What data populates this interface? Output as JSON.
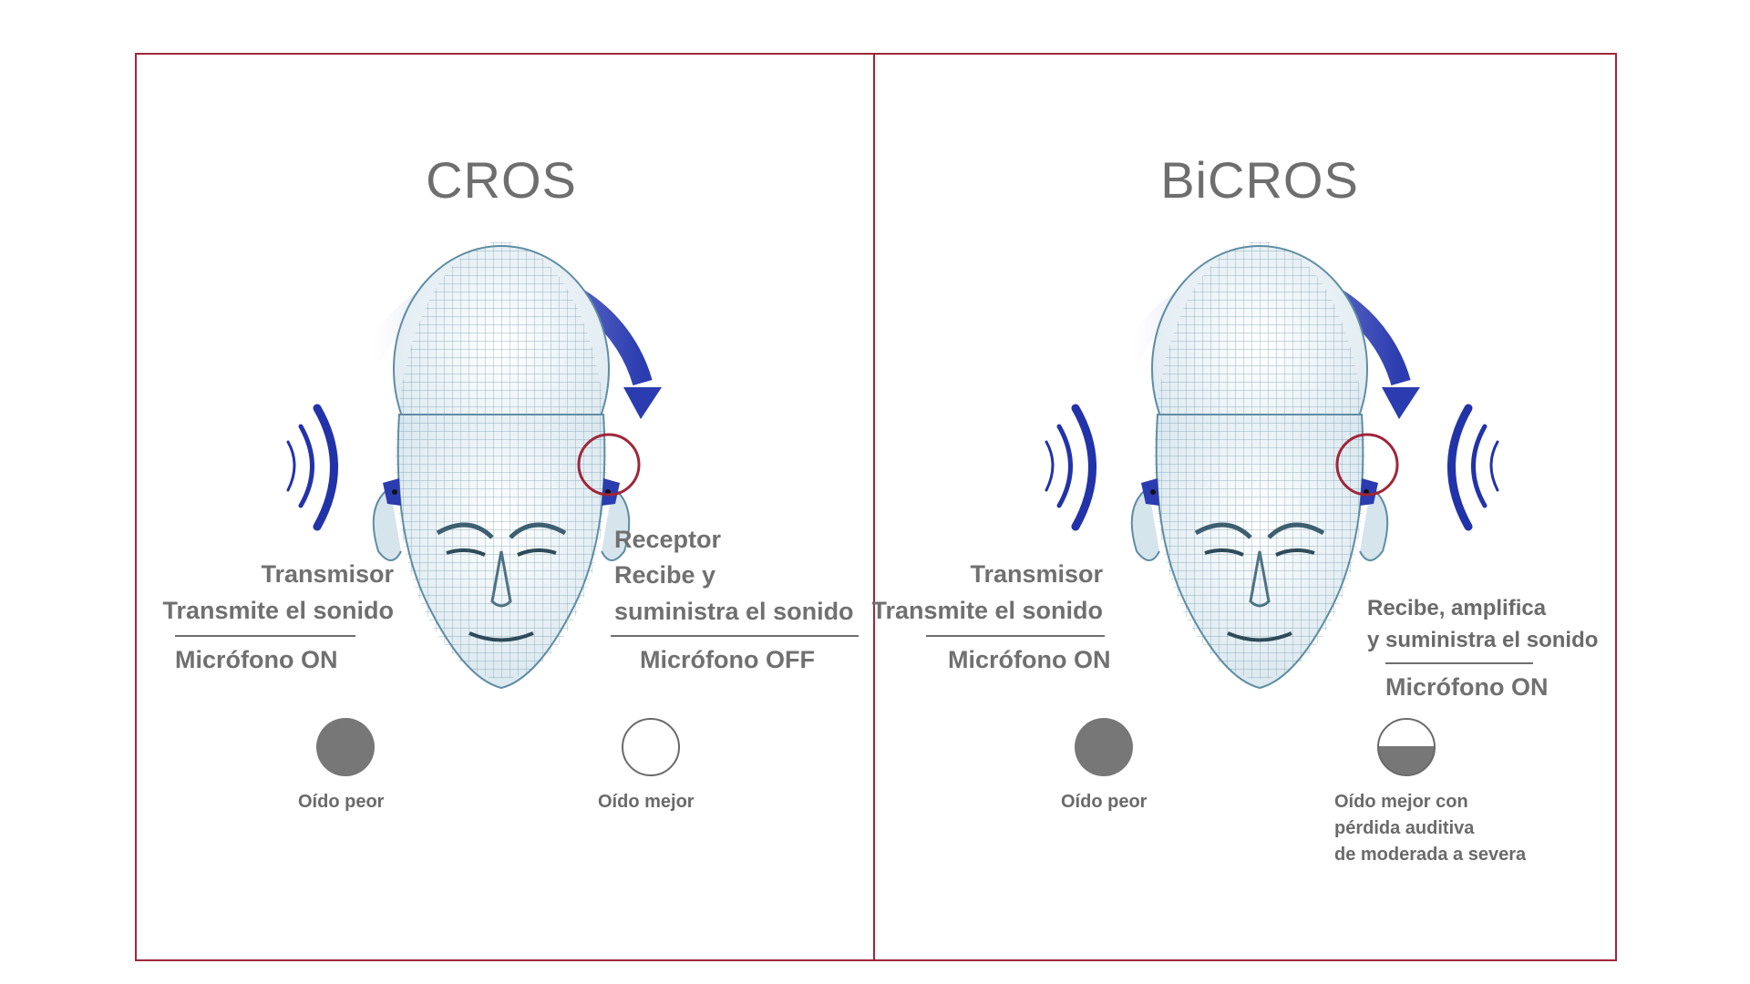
{
  "cros": {
    "title": "CROS",
    "transmitter": {
      "heading": "Transmisor",
      "desc": "Transmite el sonido",
      "mic": "Micrófono ON"
    },
    "receiver": {
      "heading": "Receptor",
      "desc_line1": "Recibe y",
      "desc_line2": "suministra el sonido",
      "mic": "Micrófono OFF"
    },
    "worse_ear": "Oído peor",
    "better_ear": "Oído mejor"
  },
  "bicros": {
    "title": "BiCROS",
    "transmitter": {
      "heading": "Transmisor",
      "desc": "Transmite el sonido",
      "mic": "Micrófono ON"
    },
    "receiver": {
      "desc_line1": "Recibe, amplifica",
      "desc_line2": "y suministra el sonido",
      "mic": "Micrófono ON"
    },
    "worse_ear": "Oído peor",
    "better_ear_line1": "Oído mejor con",
    "better_ear_line2": "pérdida auditiva",
    "better_ear_line3": "de moderada a severa"
  },
  "colors": {
    "frame": "#a0263a",
    "arrow": "#2b3cb0",
    "wave": "#2233aa",
    "text": "#707070",
    "filled_dot": "#777777"
  },
  "icons": [
    "head-icon",
    "curved-arrow-icon",
    "sound-wave-icon",
    "ear-circle-icon"
  ]
}
